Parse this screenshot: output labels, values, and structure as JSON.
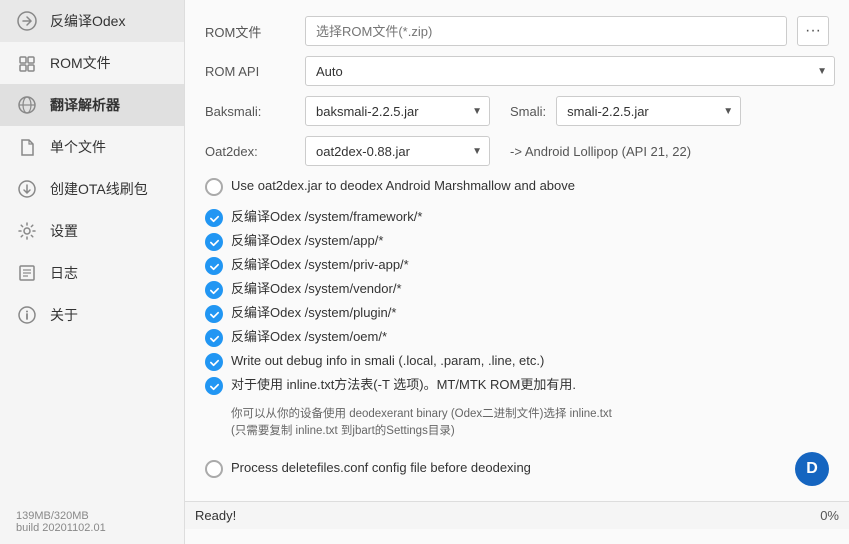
{
  "sidebar": {
    "items": [
      {
        "id": "decompile-odex",
        "label": "反编译Odex",
        "icon": "decompile"
      },
      {
        "id": "rom-file",
        "label": "ROM文件",
        "icon": "rom"
      },
      {
        "id": "translate-parser",
        "label": "翻译解析器",
        "icon": "translate",
        "active": true
      },
      {
        "id": "single-file",
        "label": "单个文件",
        "icon": "file"
      },
      {
        "id": "create-ota",
        "label": "创建OTA线刷包",
        "icon": "ota"
      },
      {
        "id": "settings",
        "label": "设置",
        "icon": "settings"
      },
      {
        "id": "log",
        "label": "日志",
        "icon": "log"
      },
      {
        "id": "about",
        "label": "关于",
        "icon": "about"
      }
    ],
    "footer": {
      "memory": "139MB/320MB",
      "build": "build 20201102.01"
    }
  },
  "main": {
    "rom_file_label": "ROM文件",
    "rom_file_placeholder": "选择ROM文件(*.zip)",
    "rom_api_label": "ROM API",
    "rom_api_value": "Auto",
    "baksmali_label": "Baksmali:",
    "baksmali_value": "baksmali-2.2.5.jar",
    "smali_label": "Smali:",
    "smali_value": "smali-2.2.5.jar",
    "oat2dex_label": "Oat2dex:",
    "oat2dex_value": "oat2dex-0.88.jar",
    "oat2dex_note": "-> Android Lollipop (API 21, 22)",
    "use_oat2dex_label": "Use oat2dex.jar to deodex Android Marshmallow and above",
    "checks": [
      {
        "checked": true,
        "label": "反编译Odex /system/framework/*"
      },
      {
        "checked": true,
        "label": "反编译Odex /system/app/*"
      },
      {
        "checked": true,
        "label": "反编译Odex /system/priv-app/*"
      },
      {
        "checked": true,
        "label": "反编译Odex /system/vendor/*"
      },
      {
        "checked": true,
        "label": "反编译Odex /system/plugin/*"
      },
      {
        "checked": true,
        "label": "反编译Odex /system/oem/*"
      },
      {
        "checked": true,
        "label": "Write out debug info in smali (.local, .param, .line, etc.)"
      },
      {
        "checked": true,
        "label": "对于使用 inline.txt方法表(-T 选项)。MT/MTK ROM更加有用."
      }
    ],
    "info_line1": "你可以从你的设备使用 deodexerant binary (Odex二进制文件)选择 inline.txt",
    "info_line2": "(只需要复制 inline.txt 到jbart的Settings目录)",
    "process_delete_label": "Process deletefiles.conf config file before deodexing",
    "avatar_letter": "D",
    "status_label": "Ready!",
    "progress_pct": "0%"
  }
}
